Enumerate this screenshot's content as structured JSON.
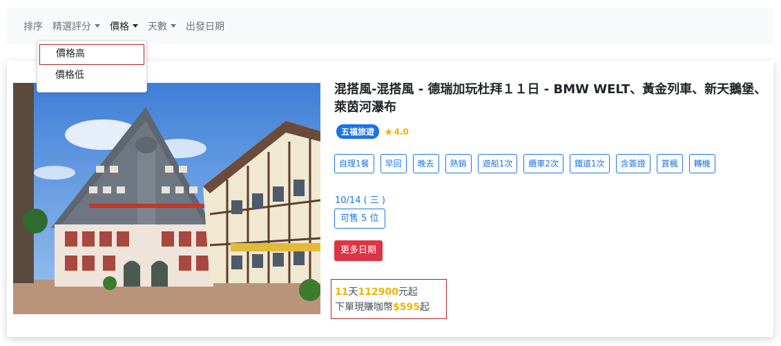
{
  "nav": {
    "sort_label": "排序",
    "items": [
      {
        "label": "精選評分",
        "has_caret": true
      },
      {
        "label": "價格",
        "has_caret": true,
        "active": true
      },
      {
        "label": "天數",
        "has_caret": true
      },
      {
        "label": "出發日期",
        "has_caret": false
      }
    ]
  },
  "dropdown": {
    "items": [
      {
        "label": "價格高",
        "highlighted": true
      },
      {
        "label": "價格低"
      }
    ]
  },
  "tour": {
    "title": "混搭風-混搭風 - 德瑞加玩杜拜１１日 - BMW WELT、黃金列車、新天鵝堡、萊茵河瀑布",
    "agency": "五福旅遊",
    "rating": "4.0",
    "tags": [
      "自理1餐",
      "早回",
      "晚去",
      "熱銷",
      "遊船1次",
      "纜車2次",
      "鐵道1次",
      "含簽證",
      "賞楓",
      "轉機"
    ],
    "date": "10/14 ( 三 )",
    "availability": "可售 5 位",
    "more_dates_label": "更多日期",
    "price": {
      "days": "11",
      "days_unit": "天",
      "amount": "112900",
      "amount_suffix": "元起",
      "coin_prefix": "下單現賺咖幣",
      "coin_amount": "$595",
      "coin_suffix": "起"
    }
  },
  "colors": {
    "accent_blue": "#1a73e8",
    "gold": "#f0b400",
    "danger_red": "#dc3545",
    "highlight_border": "#b22222"
  }
}
